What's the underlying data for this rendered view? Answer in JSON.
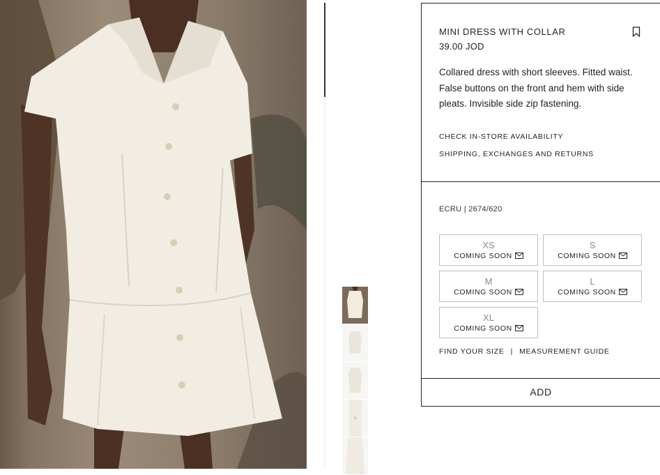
{
  "product": {
    "title": "MINI DRESS WITH COLLAR",
    "price": "39.00 JOD",
    "description": "Collared dress with short sleeves. Fitted waist. False buttons on the front and hem with side pleats. Invisible side zip fastening.",
    "links": {
      "store_availability": "CHECK IN-STORE AVAILABILITY",
      "shipping": "SHIPPING, EXCHANGES AND RETURNS"
    },
    "color_ref": "ECRU | 2674/620"
  },
  "sizes": [
    {
      "label": "XS",
      "status": "COMING SOON"
    },
    {
      "label": "S",
      "status": "COMING SOON"
    },
    {
      "label": "M",
      "status": "COMING SOON"
    },
    {
      "label": "L",
      "status": "COMING SOON"
    },
    {
      "label": "XL",
      "status": "COMING SOON"
    }
  ],
  "size_links": {
    "find_size": "FIND YOUR SIZE",
    "separator": "|",
    "measurement_guide": "MEASUREMENT GUIDE"
  },
  "add_button": "ADD",
  "icons": {
    "bookmark": "bookmark-icon",
    "envelope": "envelope-icon"
  },
  "colors": {
    "border": "#222222",
    "size_border": "#bdbdbd",
    "dress": "#f1ede2"
  }
}
